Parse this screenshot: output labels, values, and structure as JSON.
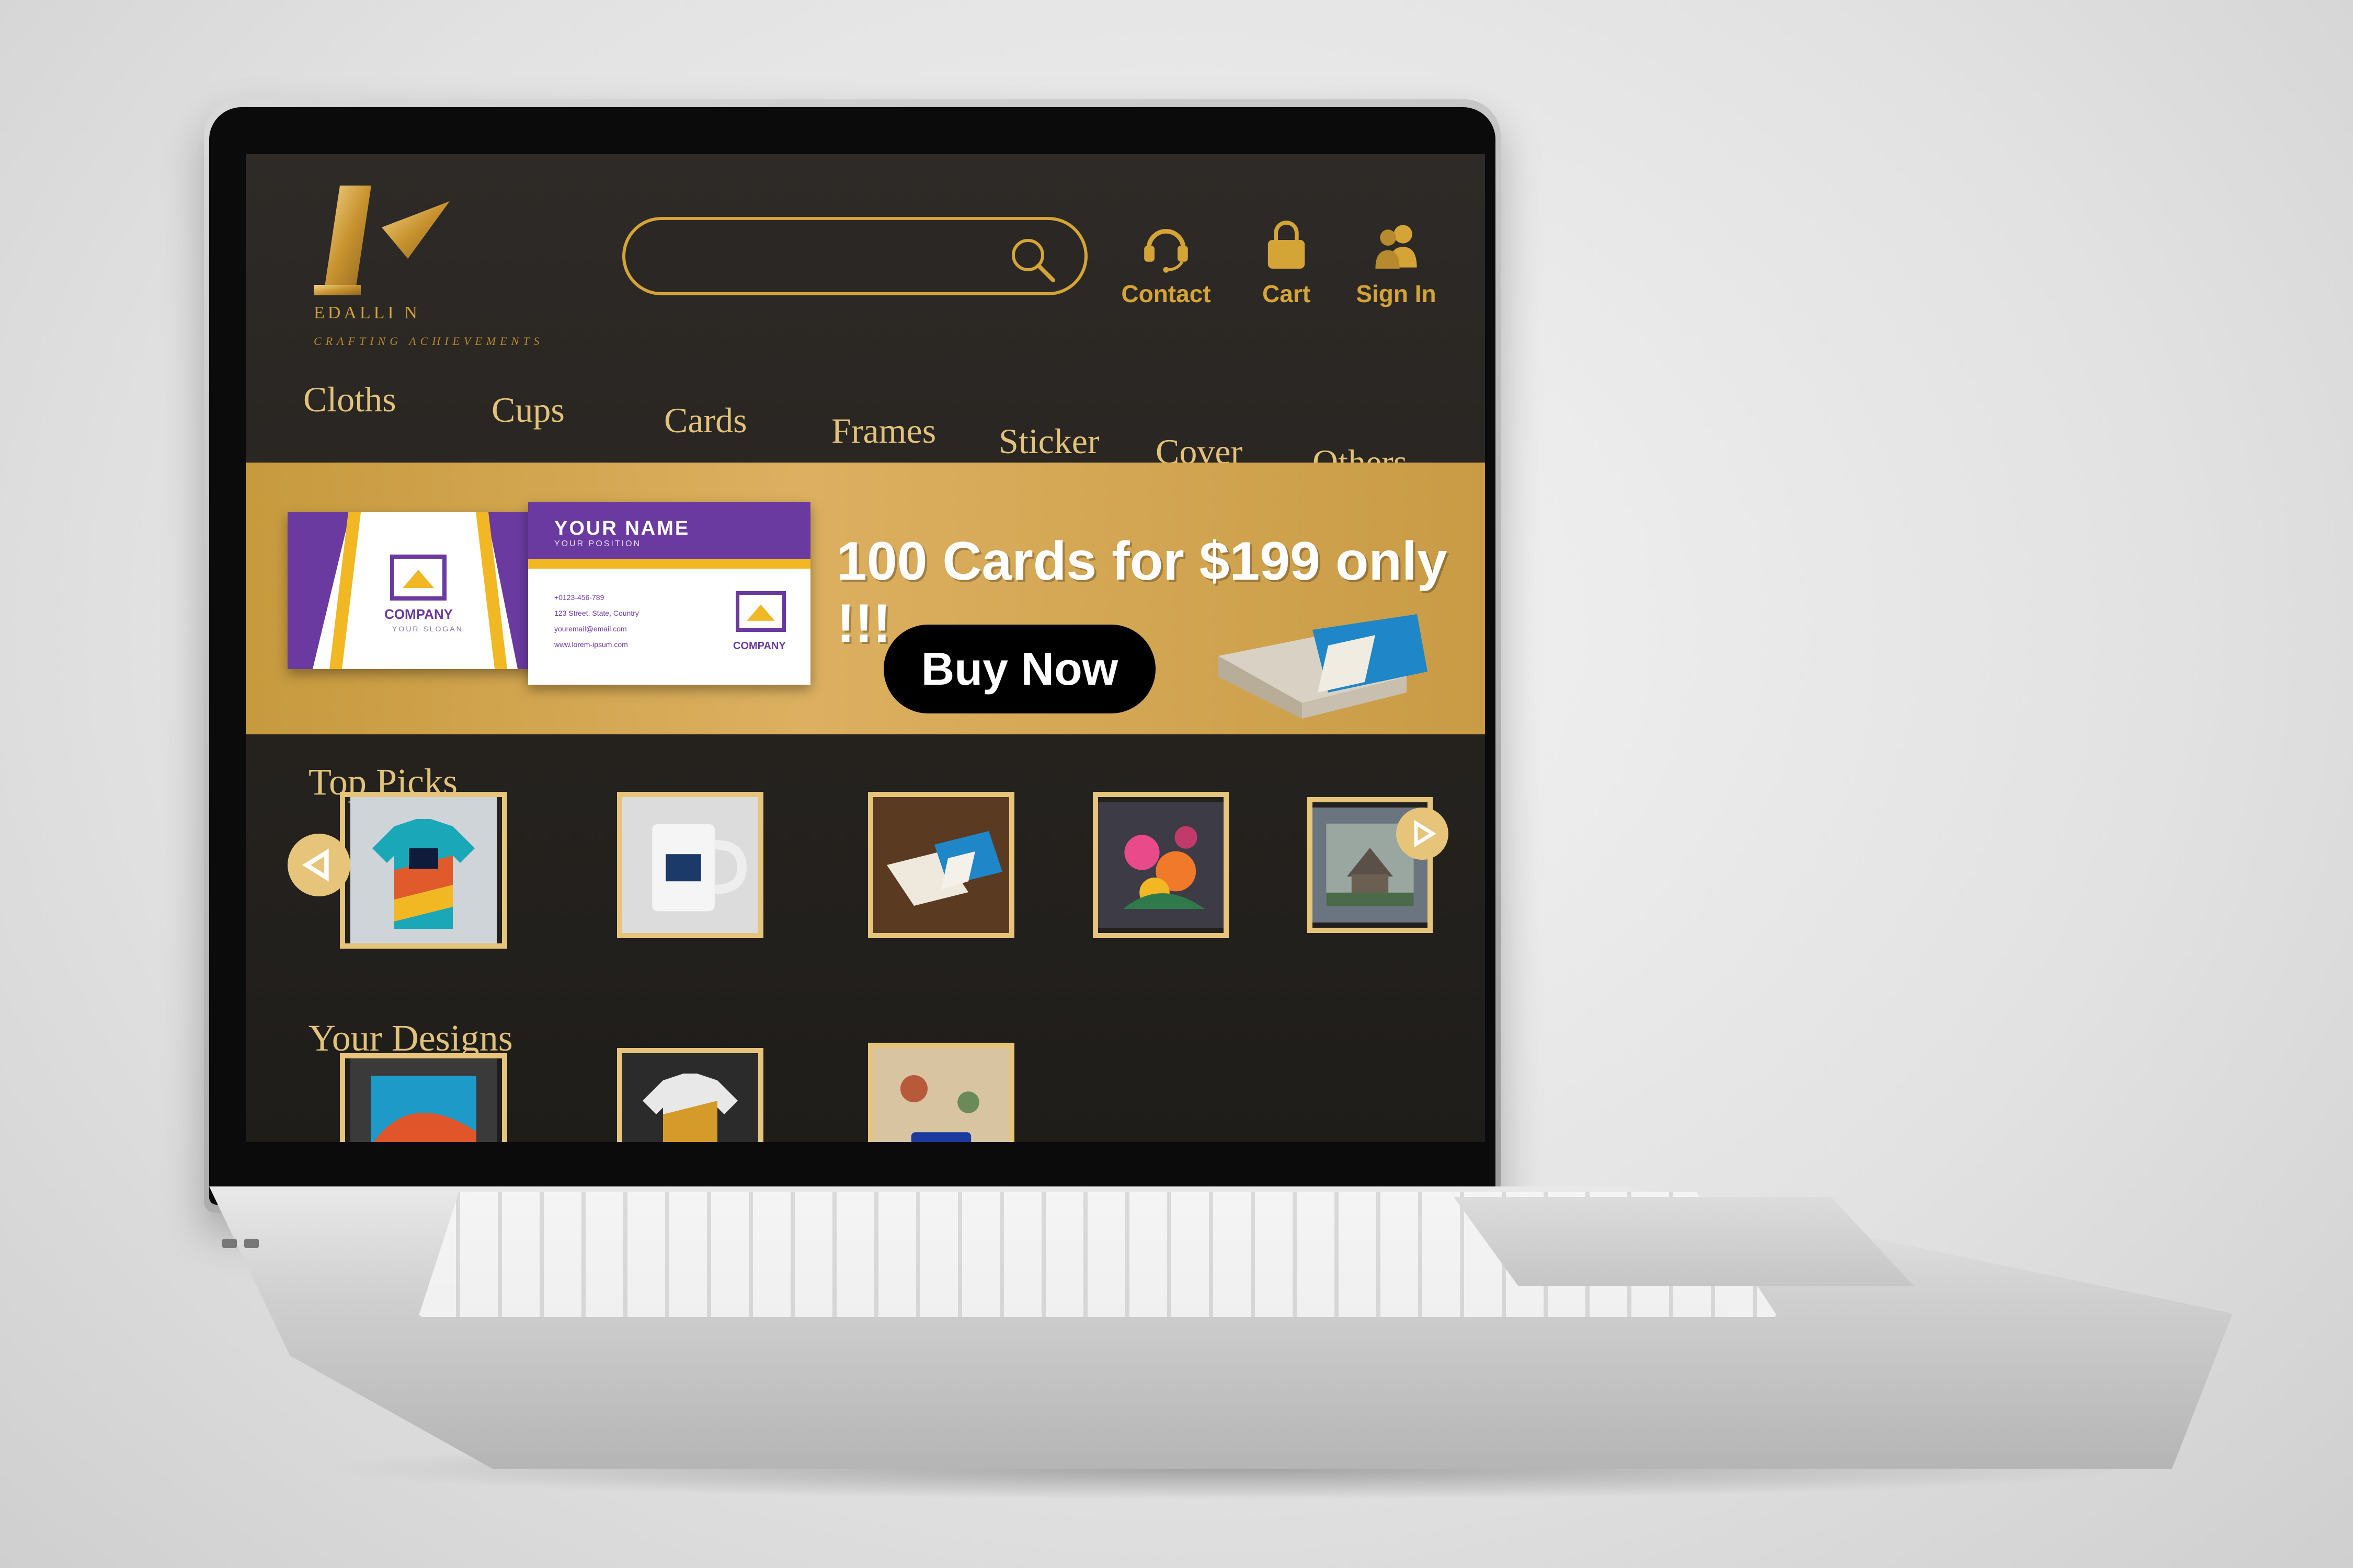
{
  "brand": {
    "wordmark": "EDALLI N",
    "tagline": "CRAFTING ACHIEVEMENTS",
    "accent": "#d4a437"
  },
  "search": {
    "value": "",
    "placeholder": ""
  },
  "header_actions": [
    {
      "label": "Contact",
      "icon": "headset-icon"
    },
    {
      "label": "Cart",
      "icon": "bag-icon"
    },
    {
      "label": "Sign In",
      "icon": "users-icon"
    }
  ],
  "nav": {
    "items": [
      "Cloths",
      "Cups",
      "Cards",
      "Frames",
      "Sticker",
      "Cover",
      "Others"
    ]
  },
  "banner": {
    "card_front": {
      "company": "COMPANY",
      "slogan": "YOUR SLOGAN"
    },
    "card_back": {
      "name": "YOUR NAME",
      "position": "YOUR POSITION",
      "phone": "+0123-456-789",
      "address": "123 Street, State, Country",
      "email": "youremail@email.com",
      "web": "www.lorem-ipsum.com",
      "company": "COMPANY"
    },
    "offer": "100 Cards for $199 only !!!",
    "cta": "Buy Now"
  },
  "top_picks": {
    "title": "Top Picks",
    "items": [
      "shirt-design",
      "mug-design",
      "business-cards",
      "floral-frame",
      "landscape-frame"
    ]
  },
  "your_designs": {
    "title": "Your Designs",
    "items": [
      "poster-art",
      "jersey-design",
      "fabric-print"
    ]
  }
}
